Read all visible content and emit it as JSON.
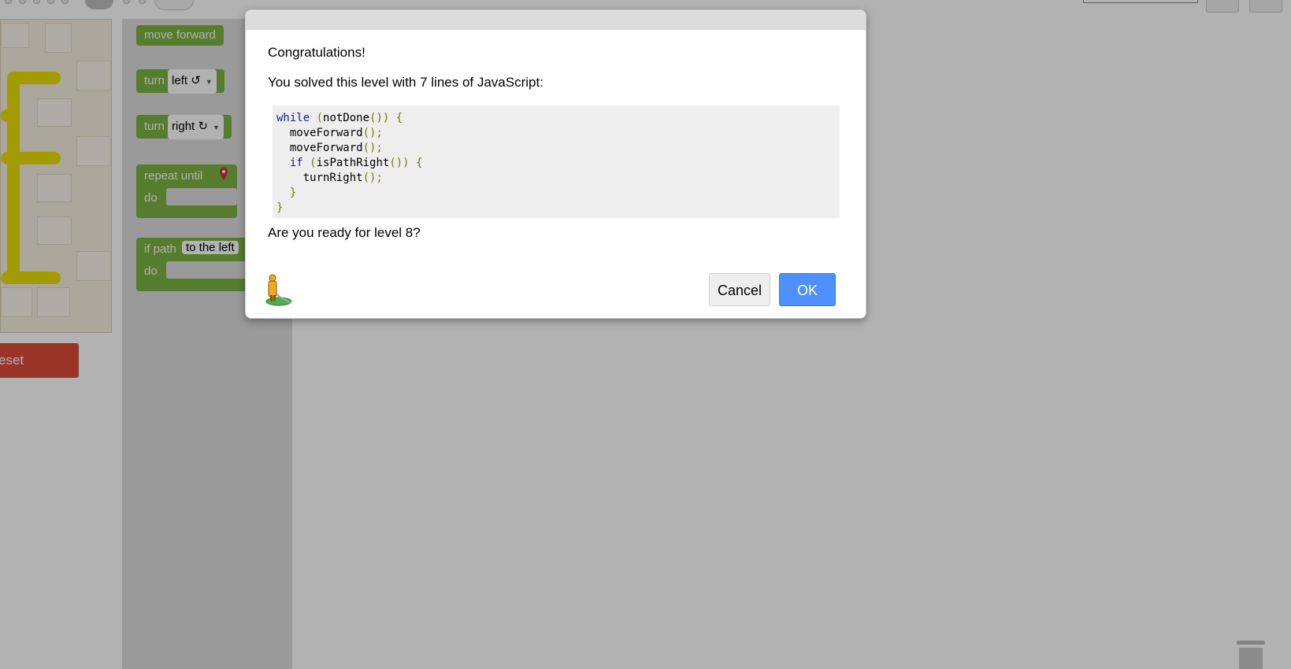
{
  "toolbox": {
    "move_forward": "move forward",
    "turn_left_prefix": "turn",
    "turn_left_value": "left ↺",
    "turn_right_prefix": "turn",
    "turn_right_value": "right ↻",
    "repeat_until": "repeat until",
    "repeat_do": "do",
    "if_path": "if path",
    "if_path_value": "to the left",
    "if_do": "do"
  },
  "reset_button_label": "eset",
  "dialog": {
    "title": "Congratulations!",
    "summary": "You solved this level with 7 lines of JavaScript:",
    "code": [
      {
        "kw": "while",
        "rest": " ",
        "pun": "(",
        "body": "notDone",
        "tail": "()) {"
      },
      {
        "kw": "",
        "rest": "  moveForward",
        "pun": "();",
        "body": "",
        "tail": ""
      },
      {
        "kw": "",
        "rest": "  moveForward",
        "pun": "();",
        "body": "",
        "tail": ""
      },
      {
        "kw": "  if",
        "rest": " ",
        "pun": "(",
        "body": "isPathRight",
        "tail": "()) {"
      },
      {
        "kw": "",
        "rest": "    turnRight",
        "pun": "();",
        "body": "",
        "tail": ""
      },
      {
        "kw": "",
        "rest": "  ",
        "pun": "}",
        "body": "",
        "tail": ""
      },
      {
        "kw": "",
        "rest": "",
        "pun": "}",
        "body": "",
        "tail": ""
      }
    ],
    "question": "Are you ready for level 8?",
    "cancel_label": "Cancel",
    "ok_label": "OK"
  },
  "colors": {
    "ok_button": "#4d90fe",
    "reset_button": "#dd4b39",
    "block": "#7cb342",
    "maze_path": "#e8e000"
  },
  "icons": {
    "dialog_icon": "pegman-icon",
    "trash": "trash-icon"
  }
}
